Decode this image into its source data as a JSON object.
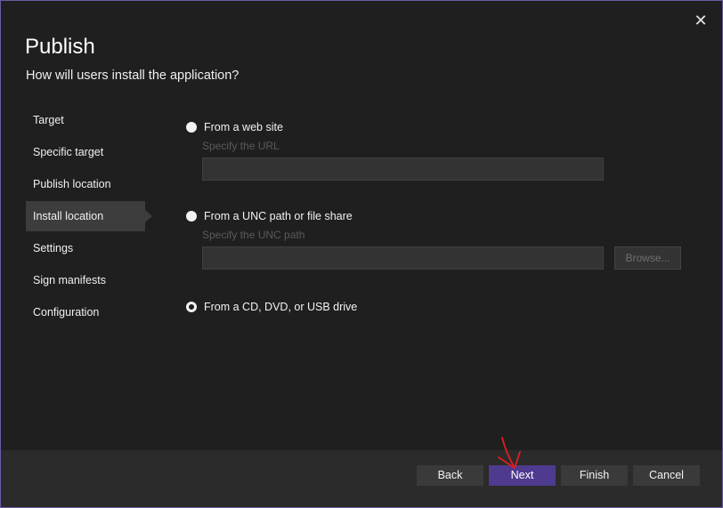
{
  "dialog": {
    "title": "Publish",
    "subtitle": "How will users install the application?",
    "close_glyph": "✕"
  },
  "nav": {
    "items": [
      {
        "label": "Target"
      },
      {
        "label": "Specific target"
      },
      {
        "label": "Publish location"
      },
      {
        "label": "Install location",
        "active": true
      },
      {
        "label": "Settings"
      },
      {
        "label": "Sign manifests"
      },
      {
        "label": "Configuration"
      }
    ]
  },
  "options": {
    "web": {
      "label": "From a web site",
      "field_label": "Specify the URL",
      "value": "",
      "selected": false
    },
    "unc": {
      "label": "From a UNC path or file share",
      "field_label": "Specify the UNC path",
      "value": "",
      "browse_label": "Browse...",
      "selected": false
    },
    "cd": {
      "label": "From a CD, DVD, or USB drive",
      "selected": true
    }
  },
  "footer": {
    "back_label": "Back",
    "next_label": "Next",
    "finish_label": "Finish",
    "cancel_label": "Cancel"
  },
  "colors": {
    "accent": "#4e3a8e",
    "border": "#6b5ba6",
    "annotation": "#e01e1e"
  }
}
